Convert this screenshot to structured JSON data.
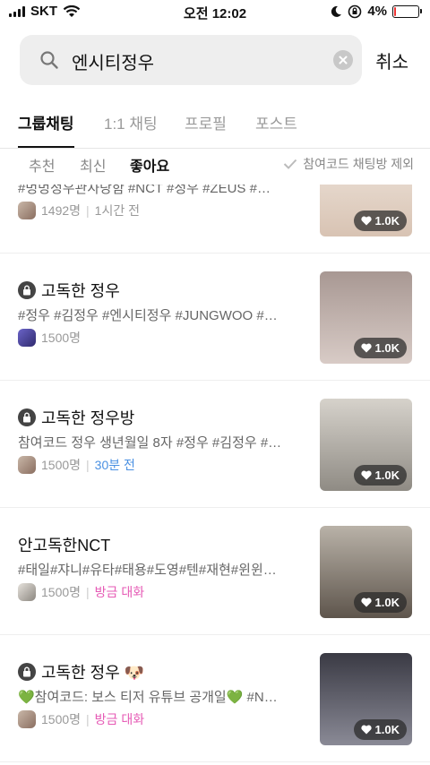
{
  "status_bar": {
    "carrier": "SKT",
    "time": "오전 12:02",
    "battery": "4%",
    "battery_level": 0.04
  },
  "search": {
    "query": "엔시티정우",
    "cancel_label": "취소"
  },
  "tabs": [
    {
      "label": "그룹채팅",
      "active": true
    },
    {
      "label": "1:1 채팅",
      "active": false
    },
    {
      "label": "프로필",
      "active": false
    },
    {
      "label": "포스트",
      "active": false
    }
  ],
  "sort": {
    "options": [
      "추천",
      "최신",
      "좋아요"
    ],
    "active": "좋아요",
    "exclude_label": "참여코드 채팅방 제외"
  },
  "rooms": [
    {
      "title": "",
      "tags": "#멍멍정우관사당함 #NCT #정우 #ZEUS #…",
      "members": "1492명",
      "time": "1시간 전",
      "likes": "1.0K",
      "thumb_color": "#e8ddd4"
    },
    {
      "title": "고독한 정우",
      "locked": true,
      "tags": "#정우 #김정우 #엔시티정우 #JUNGWOO #…",
      "members": "1500명",
      "likes": "1.0K",
      "thumb_color": "#b9a9a4"
    },
    {
      "title": "고독한 정우방",
      "locked": true,
      "tags": "참여코드 정우 생년월일 8자 #정우 #김정우 #…",
      "members": "1500명",
      "time": "30분 전",
      "likes": "1.0K",
      "thumb_color": "#c4c0b8"
    },
    {
      "title": "안고독한NCT",
      "locked": false,
      "tags": "#태일#쟈니#유타#태용#도영#텐#재현#윈윈…",
      "members": "1500명",
      "time": "방금 대화",
      "likes": "1.0K",
      "thumb_color": "#9d9185"
    },
    {
      "title": "고독한 정우 🐶",
      "locked": true,
      "tags": "💚참여코드: 보스 티저 유튜브 공개일💚 #N…",
      "members": "1500명",
      "time": "방금 대화",
      "likes": "1.0K",
      "thumb_color": "#5a5a66"
    }
  ]
}
